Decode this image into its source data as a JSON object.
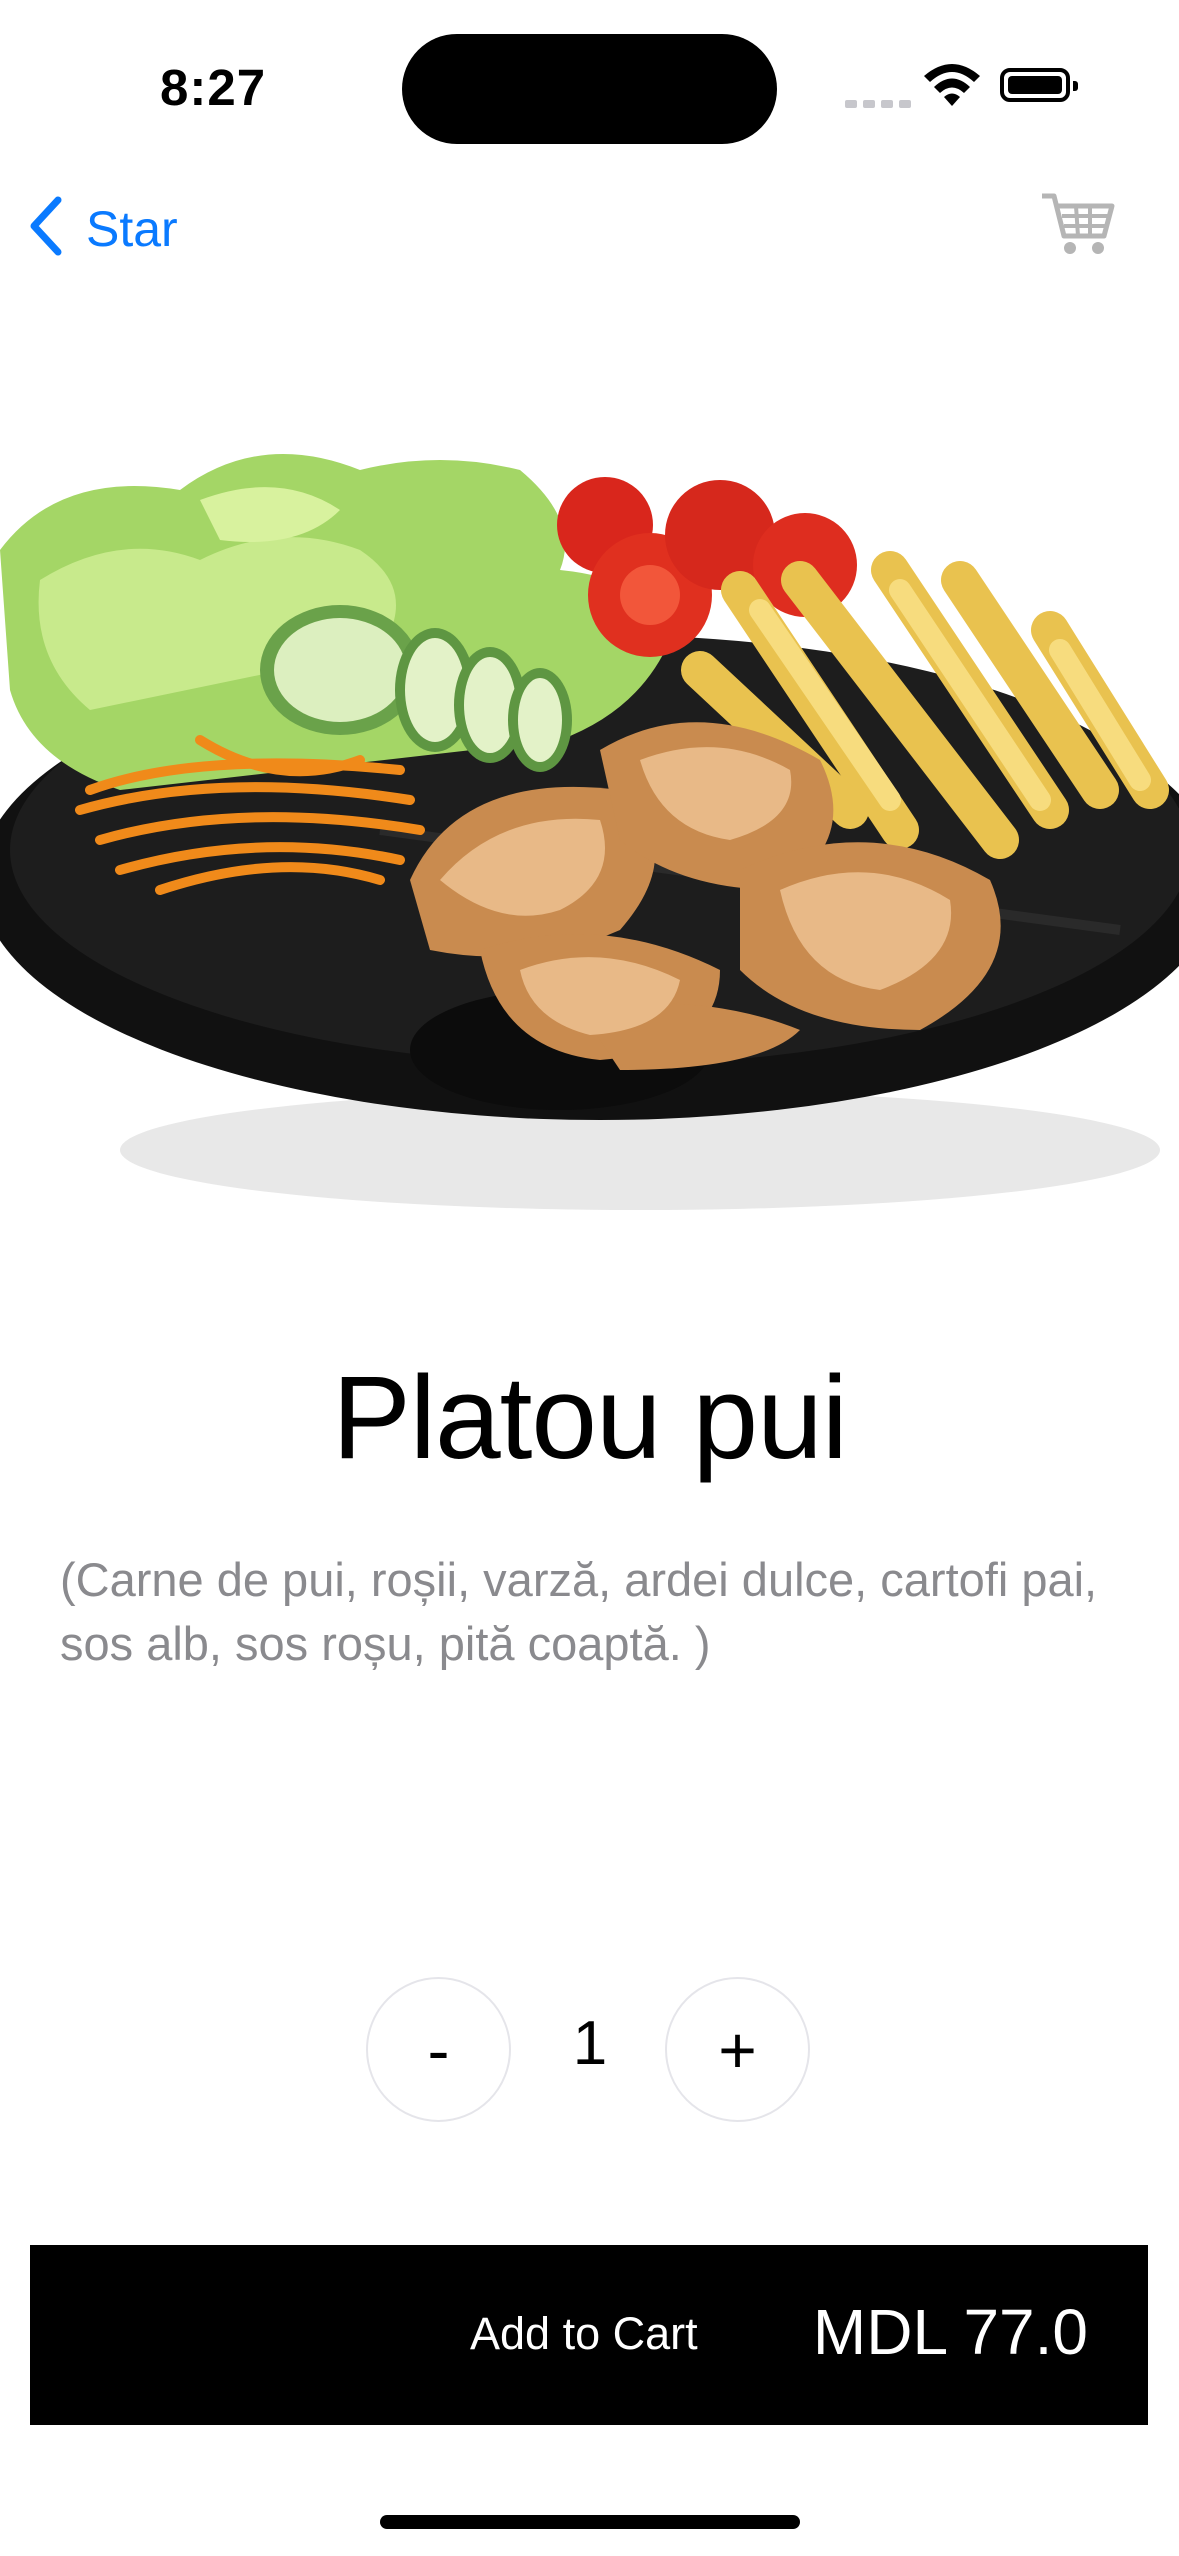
{
  "status_bar": {
    "time": "8:27"
  },
  "nav": {
    "back_label": "Star",
    "back_icon": "chevron-left-icon",
    "cart_icon": "cart-icon",
    "accent": "#0a7aff"
  },
  "product": {
    "title": "Platou pui",
    "description": "(Carne de pui, roșii, varză, ardei dulce, cartofi pai, sos alb, sos roșu, pită coaptă. )",
    "image_alt": "Platou pui"
  },
  "quantity": {
    "minus_label": "-",
    "value": "1",
    "plus_label": "+"
  },
  "cart_button": {
    "label": "Add to Cart",
    "price": "MDL 77.0"
  }
}
